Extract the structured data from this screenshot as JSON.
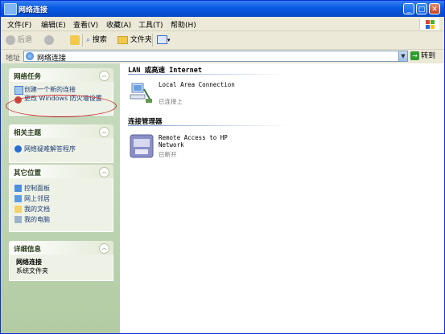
{
  "window": {
    "title": "网络连接"
  },
  "menubar": {
    "items": [
      "文件(F)",
      "编辑(E)",
      "查看(V)",
      "收藏(A)",
      "工具(T)",
      "帮助(H)"
    ]
  },
  "toolbar": {
    "back_label": "后退",
    "search_label": "搜索",
    "folders_label": "文件夹"
  },
  "address": {
    "label": "地址",
    "value": "网络连接",
    "go_label": "转到"
  },
  "tasks": {
    "network_tasks": {
      "title": "网络任务",
      "items": [
        "创建一个新的连接",
        "更改 Windows 防火墙设置"
      ]
    },
    "related": {
      "title": "相关主题",
      "items": [
        "网络疑难解答程序"
      ]
    },
    "other_places": {
      "title": "其它位置",
      "items": [
        "控制面板",
        "网上邻居",
        "我的文档",
        "我的电脑"
      ]
    },
    "details": {
      "title": "详细信息",
      "name": "网络连接",
      "type": "系统文件夹"
    }
  },
  "content": {
    "groups": [
      {
        "title": "LAN 或高速 Internet",
        "items": [
          {
            "name": "Local Area Connection",
            "status": "已连接上"
          }
        ]
      },
      {
        "title": "连接管理器",
        "items": [
          {
            "name": "Remote Access to HP Network",
            "status": "已断开"
          }
        ]
      }
    ]
  },
  "colors": {
    "titlebar": "#0A5DE4",
    "highlight": "#c83232"
  },
  "icons": [
    "back-icon",
    "forward-icon",
    "up-icon",
    "search-icon",
    "folder-icon",
    "views-icon",
    "network-icon",
    "go-icon"
  ]
}
